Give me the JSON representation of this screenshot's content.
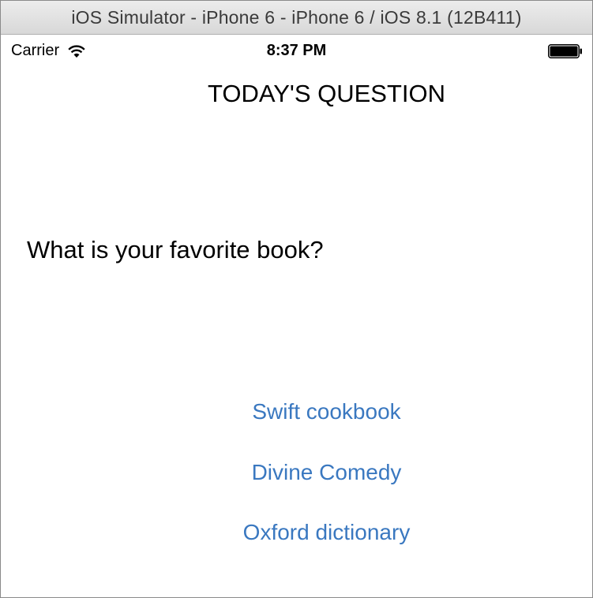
{
  "window": {
    "title": "iOS Simulator - iPhone 6 - iPhone 6 / iOS 8.1 (12B411)"
  },
  "status_bar": {
    "carrier": "Carrier",
    "time": "8:37 PM",
    "wifi_icon": "wifi-icon",
    "battery_icon": "battery-icon",
    "battery_level": 1.0
  },
  "screen": {
    "title": "TODAY'S QUESTION",
    "question": "What is your favorite book?",
    "answers": [
      {
        "label": "Swift cookbook"
      },
      {
        "label": "Divine Comedy"
      },
      {
        "label": "Oxford dictionary"
      }
    ],
    "accent_color": "#3a78c0"
  }
}
